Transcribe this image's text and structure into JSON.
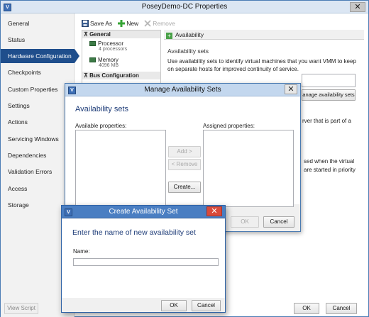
{
  "main": {
    "title": "PoseyDemo-DC Properties",
    "close_glyph": "✕",
    "nav": [
      "General",
      "Status",
      "Hardware Configuration",
      "Checkpoints",
      "Custom Properties",
      "Settings",
      "Actions",
      "Servicing Windows",
      "Dependencies",
      "Validation Errors",
      "Access",
      "Storage"
    ],
    "active_nav": "Hardware Configuration",
    "view_script": "View Script",
    "toolbar": {
      "save_as": "Save As",
      "new": "New",
      "remove": "Remove"
    },
    "tree": {
      "general_header": "General",
      "processor": "Processor",
      "processor_sub": "4 processors",
      "memory": "Memory",
      "memory_sub": "4096 MB",
      "bus_header": "Bus Configuration"
    },
    "detail": {
      "header": "Availability",
      "section_title": "Availability sets",
      "description": "Use availability sets to identify virtual machines that you want VMM to keep on separate hosts for improved continuity of service.",
      "manage_button": "anage availability sets",
      "peek_1": "rver that is part of a",
      "peek_2": "sed when the virtual",
      "peek_3": "are started in priority"
    },
    "ok": "OK",
    "cancel": "Cancel"
  },
  "manage_dialog": {
    "title": "Manage Availability Sets",
    "close_glyph": "✕",
    "heading": "Availability sets",
    "available_label": "Available properties:",
    "assigned_label": "Assigned properties:",
    "add": "Add >",
    "remove": "< Remove",
    "create": "Create...",
    "ok": "OK",
    "cancel": "Cancel"
  },
  "create_dialog": {
    "title": "Create Availability Set",
    "close_glyph": "✕",
    "heading": "Enter the name of new availability set",
    "name_label": "Name:",
    "name_value": "",
    "ok": "OK",
    "cancel": "Cancel"
  },
  "colors": {
    "accent": "#1f4e8c",
    "title_blue": "#4a7ec2",
    "close_red": "#d94a3b"
  }
}
